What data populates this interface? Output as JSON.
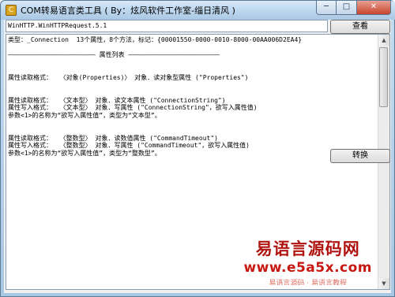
{
  "window": {
    "title": "COM转易语言类工具 ( By：炫风软件工作室-缁日清风 )",
    "app_icon": "app-icon",
    "minimize_glyph": "─",
    "maximize_glyph": "□",
    "close_glyph": "✕"
  },
  "toolbar": {
    "progid_value": "WinHTTP.WinHTTPRequest.5.1",
    "view_label": "查看",
    "convert_label": "转换"
  },
  "output": {
    "text": "类型：_Connection  13个属性，8个方法，标记：{00001550-0000-0010-8000-00AA006D2EA4}\n\n——————————————————————— 属性列表 ————————————————————————\n\n\n属性读取格式：  〈对象(Properties)〉 对象．读对象型属性 (\"Properties\")\n\n\n属性读取格式：  〈文本型〉 对象．读文本属性 (\"ConnectionString\")\n属性写入格式：  〈文本型〉 对象．写属性 (\"ConnectionString\"，欲写入属性值)\n参数<1>的名称为“欲写入属性值”，类型为“文本型”。\n\n\n属性读取格式：  〈整数型〉 对象．读数值属性 (\"CommandTimeout\")\n属性写入格式：  〈整数型〉 对象．写属性 (\"CommandTimeout\"，欲写入属性值)\n参数<1>的名称为“欲写入属性值”，类型为“整数型”。"
  },
  "scrollbar": {
    "up_glyph": "▲",
    "down_glyph": "▼"
  },
  "watermark": {
    "title": "易语言源码网",
    "url": "www.e5a5x.com",
    "sub": "易语言源码 · 易语言教程"
  }
}
